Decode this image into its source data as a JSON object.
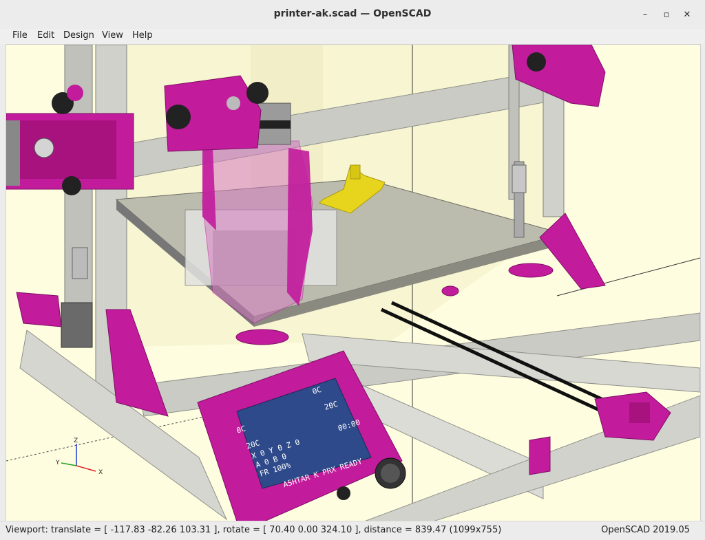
{
  "window": {
    "title": "printer-ak.scad — OpenSCAD",
    "minimize_label": "–",
    "maximize_label": "▫",
    "close_label": "✕"
  },
  "menu": {
    "items": [
      {
        "label": "File",
        "icon": ""
      },
      {
        "label": "Edit",
        "icon": ""
      },
      {
        "label": "Design",
        "icon": ""
      },
      {
        "label": "View",
        "icon": ""
      },
      {
        "label": "Help",
        "icon": ""
      }
    ]
  },
  "viewport": {
    "lcd": {
      "line_0c_left": "0C",
      "line_20c_left": "20C",
      "line_0c_right": "0C",
      "line_20c_right": "20C",
      "line_xyz": "X 0  Y 0  Z 0",
      "line_time": "00:00",
      "line_ab": "A 0 B 0",
      "line_fr": "FR 100%",
      "line_status": "ASHTAR K PRX READY"
    },
    "axes": {
      "z": "Z",
      "y": "Y",
      "x": "X"
    },
    "colors": {
      "background": "#fffde0",
      "frame_magenta": "#c21b9c",
      "aluminium": "#c9cbc4",
      "benchy_yellow": "#e6d51c",
      "lcd_blue": "#2f4a8a"
    }
  },
  "status": {
    "viewport_info": "Viewport: translate = [ -117.83 -82.26 103.31 ], rotate = [ 70.40 0.00 324.10 ], distance = 839.47 (1099x755)",
    "version": "OpenSCAD 2019.05"
  }
}
